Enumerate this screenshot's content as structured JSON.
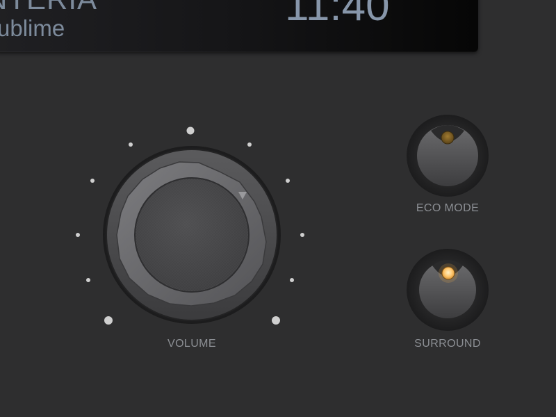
{
  "display": {
    "station": "NTERIA",
    "program": "ublime",
    "clock": "11:40"
  },
  "volume": {
    "label": "VOLUME",
    "level": 0.72
  },
  "eco_mode": {
    "label": "ECO MODE",
    "active": false,
    "indicator_color": "#8a6a2a"
  },
  "surround": {
    "label": "SURROUND",
    "active": true,
    "indicator_color": "#ffc66a"
  },
  "colors": {
    "background": "#2e2e2f",
    "display_text": "#7d8b9c",
    "label_text": "#8c8f94",
    "tick_dots": "#cfcfcf"
  }
}
